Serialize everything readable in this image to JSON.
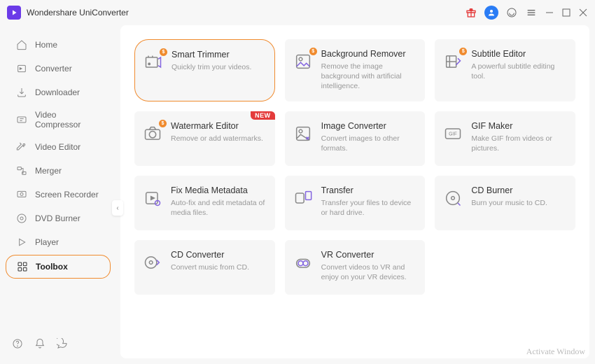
{
  "app": {
    "title": "Wondershare UniConverter"
  },
  "sidebar": {
    "items": [
      {
        "label": "Home"
      },
      {
        "label": "Converter"
      },
      {
        "label": "Downloader"
      },
      {
        "label": "Video Compressor"
      },
      {
        "label": "Video Editor"
      },
      {
        "label": "Merger"
      },
      {
        "label": "Screen Recorder"
      },
      {
        "label": "DVD Burner"
      },
      {
        "label": "Player"
      },
      {
        "label": "Toolbox"
      }
    ]
  },
  "tools": [
    {
      "title": "Smart Trimmer",
      "desc": "Quickly trim your videos.",
      "coin": "$",
      "highlight": true
    },
    {
      "title": "Background Remover",
      "desc": "Remove the image background with artificial intelligence.",
      "coin": "$"
    },
    {
      "title": "Subtitle Editor",
      "desc": "A powerful subtitle editing tool.",
      "coin": "$"
    },
    {
      "title": "Watermark Editor",
      "desc": "Remove or add watermarks.",
      "coin": "$",
      "badge": "NEW"
    },
    {
      "title": "Image Converter",
      "desc": "Convert images to other formats."
    },
    {
      "title": "GIF Maker",
      "desc": "Make GIF from videos or pictures."
    },
    {
      "title": "Fix Media Metadata",
      "desc": "Auto-fix and edit metadata of media files."
    },
    {
      "title": "Transfer",
      "desc": "Transfer your files to device or hard drive."
    },
    {
      "title": "CD Burner",
      "desc": "Burn your music to CD."
    },
    {
      "title": "CD Converter",
      "desc": "Convert music from CD."
    },
    {
      "title": "VR Converter",
      "desc": "Convert videos to VR and enjoy on your VR devices."
    }
  ],
  "watermark": "Activate Window"
}
